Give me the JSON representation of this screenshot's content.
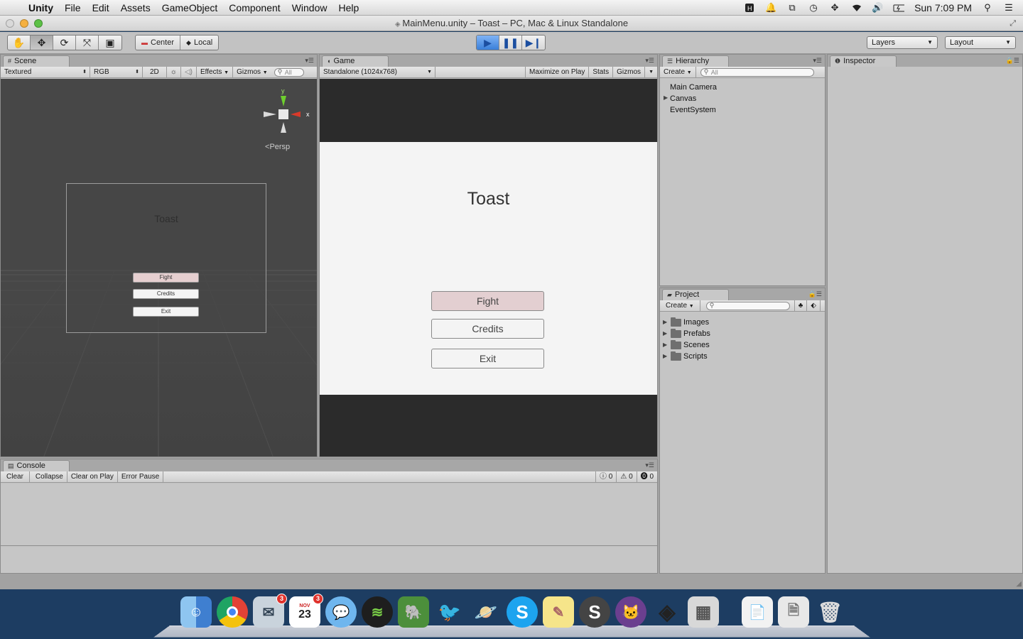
{
  "menubar": {
    "app_name": "Unity",
    "items": [
      "File",
      "Edit",
      "Assets",
      "GameObject",
      "Component",
      "Window",
      "Help"
    ],
    "clock": "Sun 7:09 PM"
  },
  "window": {
    "title": "MainMenu.unity – Toast – PC, Mac & Linux Standalone"
  },
  "toolbar": {
    "pivot_mode": "Center",
    "pivot_space": "Local",
    "layers_label": "Layers",
    "layout_label": "Layout"
  },
  "scene": {
    "tab": "Scene",
    "shading": "Textured",
    "render_mode": "RGB",
    "mode_2d": "2D",
    "effects": "Effects",
    "gizmos": "Gizmos",
    "search_placeholder": "All",
    "gizmo_axes": {
      "x": "x",
      "y": "y"
    },
    "persp_label": "Persp",
    "canvas_title": "Toast",
    "buttons": [
      "Fight",
      "Credits",
      "Exit"
    ]
  },
  "game": {
    "tab": "Game",
    "resolution": "Standalone (1024x768)",
    "maximize": "Maximize on Play",
    "stats": "Stats",
    "gizmos": "Gizmos",
    "title": "Toast",
    "buttons": {
      "fight": "Fight",
      "credits": "Credits",
      "exit": "Exit"
    }
  },
  "hierarchy": {
    "tab": "Hierarchy",
    "create": "Create",
    "search_placeholder": "All",
    "items": [
      "Main Camera",
      "Canvas",
      "EventSystem"
    ]
  },
  "project": {
    "tab": "Project",
    "create": "Create",
    "folders": [
      "Images",
      "Prefabs",
      "Scenes",
      "Scripts"
    ]
  },
  "inspector": {
    "tab": "Inspector"
  },
  "console": {
    "tab": "Console",
    "buttons": [
      "Clear",
      "Collapse",
      "Clear on Play",
      "Error Pause"
    ],
    "counts": {
      "info": "0",
      "warn": "0",
      "error": "0"
    }
  },
  "dock": {
    "apps": [
      "Finder",
      "Chrome",
      "Mail",
      "Calendar",
      "Messages",
      "Spotify",
      "Evernote",
      "Tweetbot",
      "Saturn",
      "Skype",
      "Stickies",
      "Sublime",
      "GitHub",
      "Unity",
      "Calculator",
      "Preview",
      "Documents",
      "Trash"
    ],
    "mail_badge": "3",
    "calendar_badge": "3",
    "calendar_date": "23",
    "calendar_month": "NOV"
  }
}
